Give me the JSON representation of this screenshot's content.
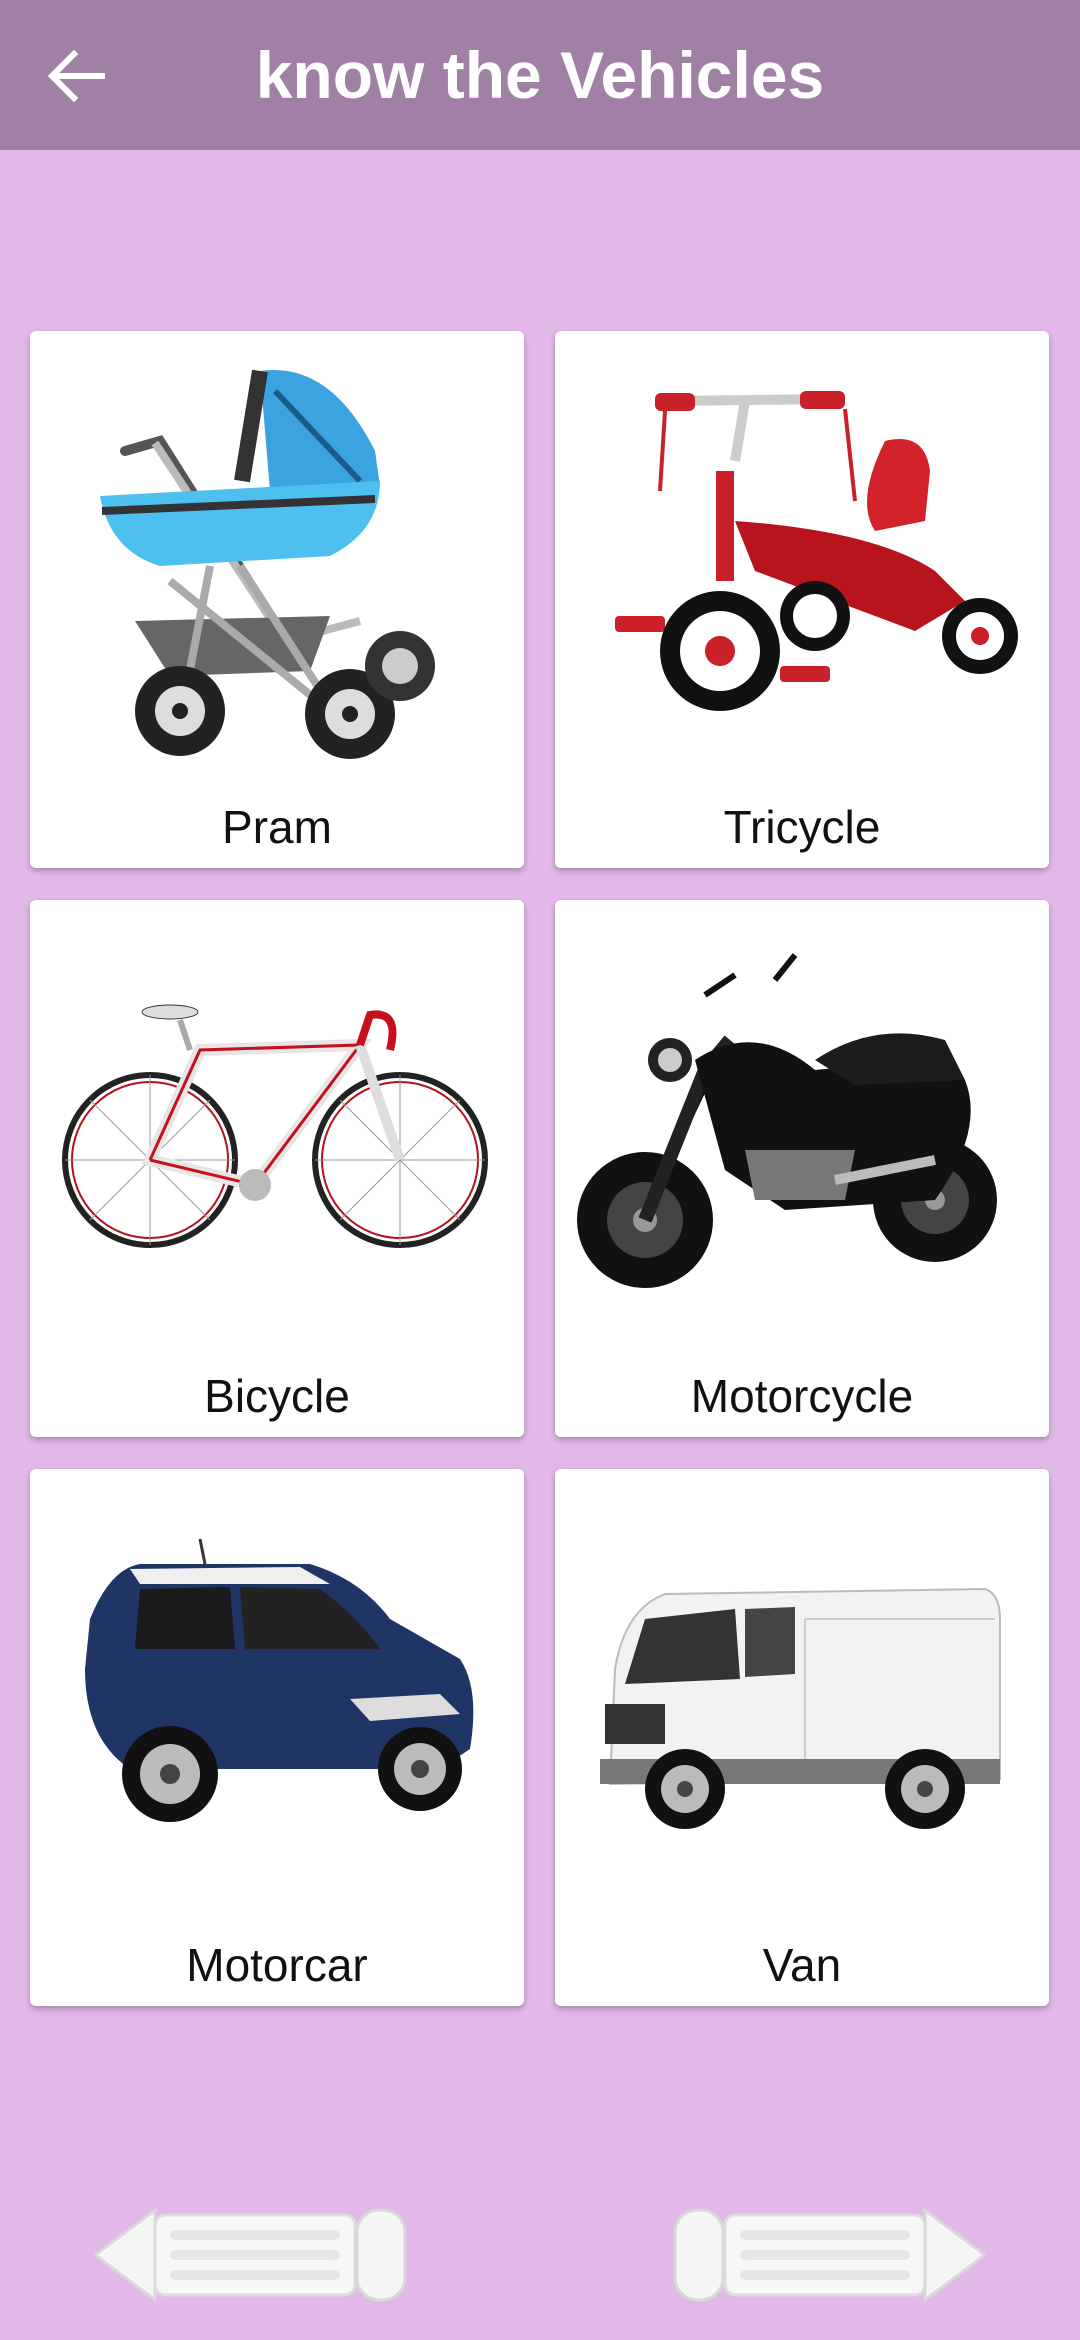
{
  "appbar": {
    "title": "know the Vehicles",
    "back_icon": "arrow-left-icon",
    "bg_color": "#a180a6"
  },
  "page": {
    "bg_color": "#e1b8e8"
  },
  "vehicles": [
    {
      "label": "Pram",
      "image": "pram"
    },
    {
      "label": "Tricycle",
      "image": "tricycle"
    },
    {
      "label": "Bicycle",
      "image": "bicycle"
    },
    {
      "label": "Motorcycle",
      "image": "motorcycle"
    },
    {
      "label": "Motorcar",
      "image": "motorcar"
    },
    {
      "label": "Van",
      "image": "van"
    }
  ],
  "footer": {
    "prev_icon": "pencil-arrow-left-icon",
    "next_icon": "pencil-arrow-right-icon"
  }
}
